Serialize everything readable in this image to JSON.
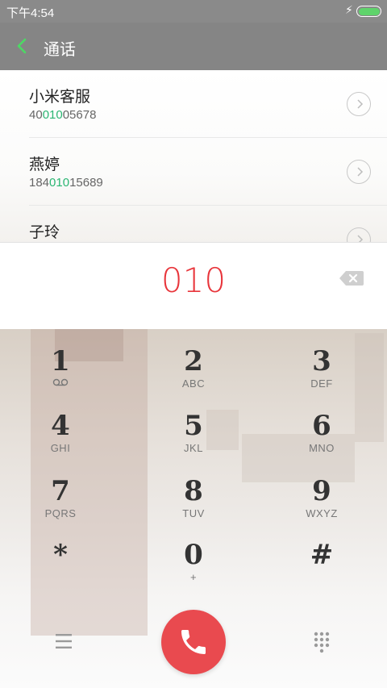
{
  "status_bar": {
    "time": "下午4:54",
    "charging_icon": "bolt-icon",
    "battery_color": "#5fd36b"
  },
  "header": {
    "title": "通话",
    "back_icon": "chevron-left-icon",
    "accent": "#4cd964"
  },
  "contacts": [
    {
      "name": "小米客服",
      "number_prefix": "40",
      "number_match": "010",
      "number_suffix": "05678"
    },
    {
      "name": "燕婷",
      "number_prefix": "184",
      "number_match": "010",
      "number_suffix": "15689"
    },
    {
      "name": "子玲",
      "number_prefix": "",
      "number_match": "",
      "number_suffix": ""
    }
  ],
  "dialer": {
    "input": "010",
    "input_color": "#e8353b",
    "match_color": "#2bb673"
  },
  "keys": [
    {
      "digit": "1",
      "sub": ""
    },
    {
      "digit": "2",
      "sub": "ABC"
    },
    {
      "digit": "3",
      "sub": "DEF"
    },
    {
      "digit": "4",
      "sub": "GHI"
    },
    {
      "digit": "5",
      "sub": "JKL"
    },
    {
      "digit": "6",
      "sub": "MNO"
    },
    {
      "digit": "7",
      "sub": "PQRS"
    },
    {
      "digit": "8",
      "sub": "TUV"
    },
    {
      "digit": "9",
      "sub": "WXYZ"
    },
    {
      "digit": "*",
      "sub": ""
    },
    {
      "digit": "0",
      "sub": "+"
    },
    {
      "digit": "#",
      "sub": ""
    }
  ],
  "bottom_bar": {
    "menu_icon": "menu-icon",
    "call_icon": "phone-icon",
    "dialpad_icon": "dialpad-icon",
    "call_color": "#e94a4f"
  }
}
